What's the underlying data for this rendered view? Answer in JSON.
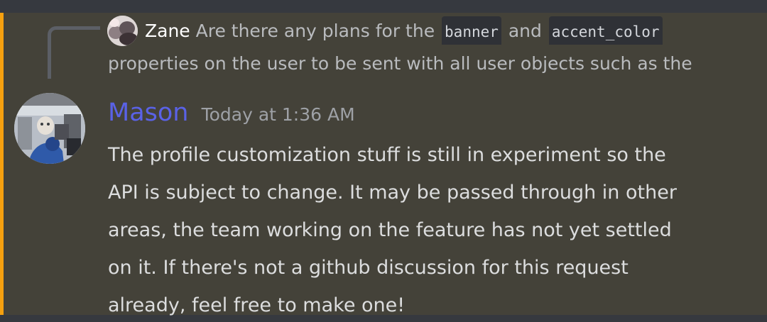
{
  "reply": {
    "username": "Zane",
    "text_before": "Are there any plans for the",
    "code_1": "banner",
    "text_between": "and",
    "code_2": "accent_color",
    "line_2": "properties on the user to be sent with all user objects such as the"
  },
  "message": {
    "author": "Mason",
    "timestamp": "Today at 1:36 AM",
    "lines": [
      "The profile customization stuff is still in experiment so the",
      "API is subject to change. It may be passed through in other",
      "areas, the team working on the feature has not yet settled",
      "on it. If there's not a github discussion for this request",
      "already, feel free to make one!"
    ]
  },
  "colors": {
    "mention_accent": "#f5a00f",
    "author_color": "#5a62e6",
    "message_bg": "#444239",
    "page_bg": "#36393f"
  }
}
